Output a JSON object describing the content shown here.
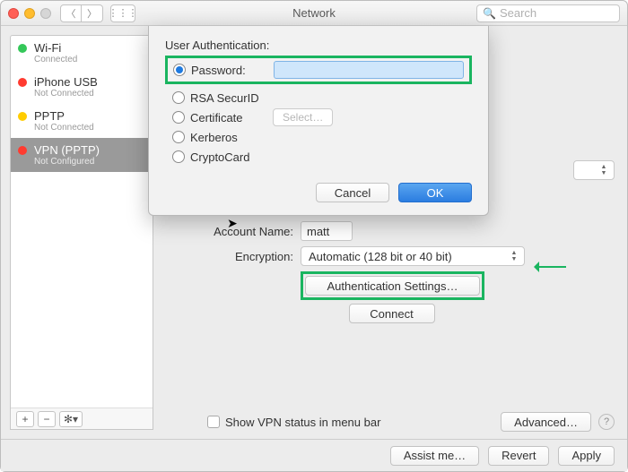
{
  "window": {
    "title": "Network"
  },
  "search": {
    "placeholder": "Search"
  },
  "sidebar": {
    "items": [
      {
        "name": "Wi-Fi",
        "status": "Connected",
        "led": "#34c759"
      },
      {
        "name": "iPhone USB",
        "status": "Not Connected",
        "led": "#ff3b30"
      },
      {
        "name": "PPTP",
        "status": "Not Connected",
        "led": "#ffcc00"
      },
      {
        "name": "VPN (PPTP)",
        "status": "Not Configured",
        "led": "#ff3b30"
      }
    ]
  },
  "details": {
    "account_name_label": "Account Name:",
    "account_name_value": "matt",
    "encryption_label": "Encryption:",
    "encryption_value": "Automatic (128 bit or 40 bit)",
    "auth_settings_label": "Authentication Settings…",
    "connect_label": "Connect",
    "show_status_label": "Show VPN status in menu bar",
    "advanced_label": "Advanced…"
  },
  "sheet": {
    "title": "User Authentication:",
    "options": {
      "password": "Password:",
      "rsa": "RSA SecurID",
      "certificate": "Certificate",
      "kerberos": "Kerberos",
      "cryptocard": "CryptoCard",
      "select_btn": "Select…"
    },
    "password_value": "",
    "cancel": "Cancel",
    "ok": "OK"
  },
  "footer": {
    "assist": "Assist me…",
    "revert": "Revert",
    "apply": "Apply"
  }
}
